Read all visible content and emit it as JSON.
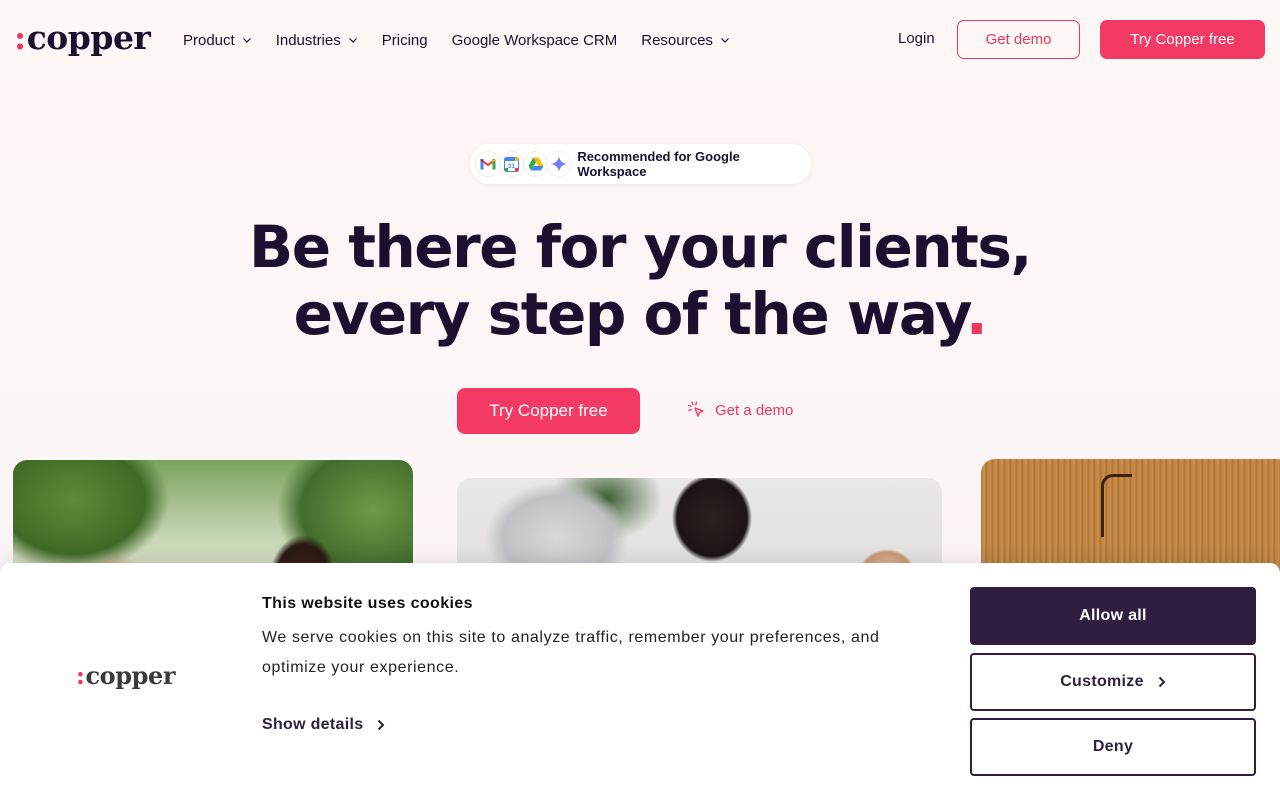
{
  "header": {
    "logo_text": "copper",
    "logo_colon": ":",
    "nav": [
      {
        "label": "Product",
        "has_dropdown": true
      },
      {
        "label": "Industries",
        "has_dropdown": true
      },
      {
        "label": "Pricing",
        "has_dropdown": false
      },
      {
        "label": "Google Workspace CRM",
        "has_dropdown": false
      },
      {
        "label": "Resources",
        "has_dropdown": true
      }
    ],
    "login_label": "Login",
    "get_demo_label": "Get demo",
    "try_free_label": "Try Copper free"
  },
  "hero": {
    "badge_text": "Recommended for Google Workspace",
    "badge_icons": [
      "gmail-icon",
      "google-calendar-icon",
      "google-drive-icon",
      "gemini-icon"
    ],
    "title_line1": "Be there for your clients,",
    "title_line2": "every step of the way",
    "title_dot": ".",
    "cta_primary": "Try Copper free",
    "cta_secondary": "Get a demo"
  },
  "cookie_banner": {
    "logo_text": "copper",
    "logo_colon": ":",
    "title": "This website uses cookies",
    "text": "We serve cookies on this site to analyze traffic, remember your preferences, and optimize your experience.",
    "show_details_label": "Show details",
    "allow_all_label": "Allow all",
    "customize_label": "Customize",
    "deny_label": "Deny"
  },
  "colors": {
    "brand_pink": "#f23a65",
    "brand_dark": "#1d0f2f",
    "cookie_dark": "#2e1f40"
  }
}
